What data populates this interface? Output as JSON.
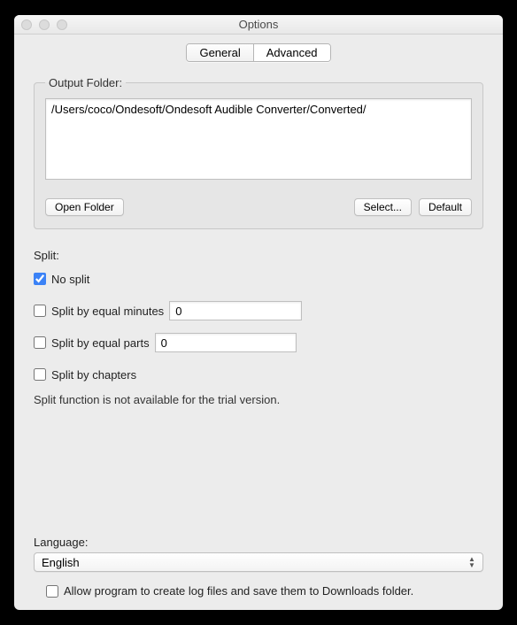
{
  "window": {
    "title": "Options"
  },
  "tabs": {
    "general": "General",
    "advanced": "Advanced",
    "active": "advanced"
  },
  "outputFolder": {
    "legend": "Output Folder:",
    "path": "/Users/coco/Ondesoft/Ondesoft Audible Converter/Converted/",
    "openFolder": "Open Folder",
    "select": "Select...",
    "default": "Default"
  },
  "split": {
    "legend": "Split:",
    "noSplit": {
      "label": "No split",
      "checked": true
    },
    "equalMinutes": {
      "label": "Split by equal minutes",
      "checked": false,
      "value": "0"
    },
    "equalParts": {
      "label": "Split by equal parts",
      "checked": false,
      "value": "0"
    },
    "chapters": {
      "label": "Split by chapters",
      "checked": false
    },
    "note": "Split function is not available for the trial version."
  },
  "language": {
    "label": "Language:",
    "value": "English"
  },
  "log": {
    "label": "Allow program to create log files and save them to Downloads folder.",
    "checked": false
  }
}
